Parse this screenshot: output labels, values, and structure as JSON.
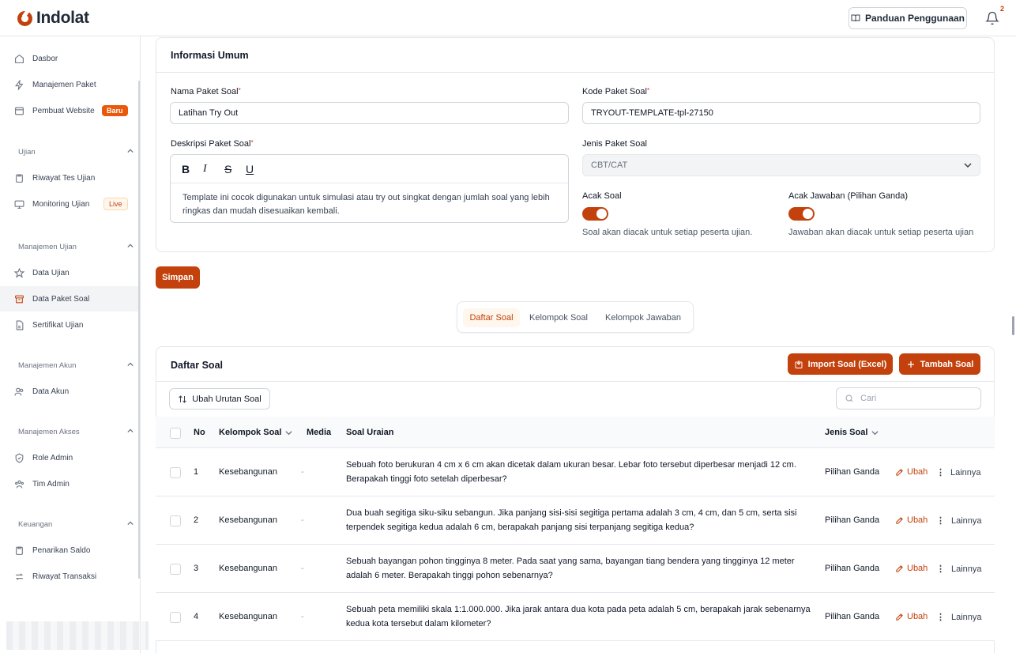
{
  "app": {
    "logo_text": "Indolat",
    "brand_color": "#c2410c"
  },
  "topbar": {
    "guide_label": "Panduan Penggunaan",
    "notif_count": "2"
  },
  "sidebar": {
    "items_top": [
      {
        "label": "Dasbor",
        "icon": "home-icon"
      },
      {
        "label": "Manajemen Paket",
        "icon": "bolt-icon"
      },
      {
        "label": "Pembuat Website",
        "icon": "window-icon",
        "badge": "Baru"
      }
    ],
    "sections": [
      {
        "title": "Ujian",
        "items": [
          {
            "label": "Riwayat Tes Ujian",
            "icon": "clipboard-icon"
          },
          {
            "label": "Monitoring Ujian",
            "icon": "monitor-icon",
            "badge": "Live"
          }
        ]
      },
      {
        "title": "Manajemen Ujian",
        "items": [
          {
            "label": "Data Ujian",
            "icon": "star-icon"
          },
          {
            "label": "Data Paket Soal",
            "icon": "archive-icon"
          },
          {
            "label": "Sertifikat Ujian",
            "icon": "file-icon"
          }
        ]
      },
      {
        "title": "Manajemen Akun",
        "items": [
          {
            "label": "Data Akun",
            "icon": "users-icon"
          }
        ]
      },
      {
        "title": "Manajemen Akses",
        "items": [
          {
            "label": "Role Admin",
            "icon": "shield-icon"
          },
          {
            "label": "Tim Admin",
            "icon": "team-icon"
          }
        ]
      },
      {
        "title": "Keuangan",
        "items": [
          {
            "label": "Penarikan Saldo",
            "icon": "clipboard-icon"
          },
          {
            "label": "Riwayat Transaksi",
            "icon": "transfer-icon"
          }
        ]
      }
    ]
  },
  "form": {
    "title": "Informasi Umum",
    "name_label": "Nama Paket Soal",
    "name_value": "Latihan Try Out",
    "code_label": "Kode Paket Soal",
    "code_value": "TRYOUT-TEMPLATE-tpl-27150",
    "desc_label": "Deskripsi Paket Soal",
    "desc_value": "Template ini cocok digunakan untuk simulasi atau try out singkat dengan jumlah soal yang lebih ringkas dan mudah disesuaikan kembali.",
    "type_label": "Jenis Paket Soal",
    "type_value": "CBT/CAT",
    "shuffle_q_label": "Acak Soal",
    "shuffle_q_hint": "Soal akan diacak untuk setiap peserta ujian.",
    "shuffle_a_label": "Acak Jawaban (Pilihan Ganda)",
    "shuffle_a_hint": "Jawaban akan diacak untuk setiap peserta ujian",
    "save_label": "Simpan"
  },
  "tabs": [
    {
      "label": "Daftar Soal",
      "active": true
    },
    {
      "label": "Kelompok Soal",
      "active": false
    },
    {
      "label": "Kelompok Jawaban",
      "active": false
    }
  ],
  "questions": {
    "title": "Daftar Soal",
    "import_label": "Import Soal (Excel)",
    "add_label": "Tambah Soal",
    "reorder_label": "Ubah Urutan Soal",
    "search_placeholder": "Cari",
    "columns": {
      "no": "No",
      "group": "Kelompok Soal",
      "media": "Media",
      "question": "Soal Uraian",
      "type": "Jenis Soal"
    },
    "edit_label": "Ubah",
    "more_label": "Lainnya",
    "rows": [
      {
        "no": "1",
        "group": "Kesebangunan",
        "media": "-",
        "question": "Sebuah foto berukuran 4 cm x 6 cm akan dicetak dalam ukuran besar. Lebar foto tersebut diperbesar menjadi 12 cm. Berapakah tinggi foto setelah diperbesar?",
        "type": "Pilihan Ganda"
      },
      {
        "no": "2",
        "group": "Kesebangunan",
        "media": "-",
        "question": "Dua buah segitiga siku-siku sebangun. Jika panjang sisi-sisi segitiga pertama adalah 3 cm, 4 cm, dan 5 cm, serta sisi terpendek segitiga kedua adalah 6 cm, berapakah panjang sisi terpanjang segitiga kedua?",
        "type": "Pilihan Ganda"
      },
      {
        "no": "3",
        "group": "Kesebangunan",
        "media": "-",
        "question": "Sebuah bayangan pohon tingginya 8 meter. Pada saat yang sama, bayangan tiang bendera yang tingginya 12 meter adalah 6 meter. Berapakah tinggi pohon sebenarnya?",
        "type": "Pilihan Ganda"
      },
      {
        "no": "4",
        "group": "Kesebangunan",
        "media": "-",
        "question": "Sebuah peta memiliki skala 1:1.000.000. Jika jarak antara dua kota pada peta adalah 5 cm, berapakah jarak sebenarnya kedua kota tersebut dalam kilometer?",
        "type": "Pilihan Ganda"
      }
    ]
  }
}
